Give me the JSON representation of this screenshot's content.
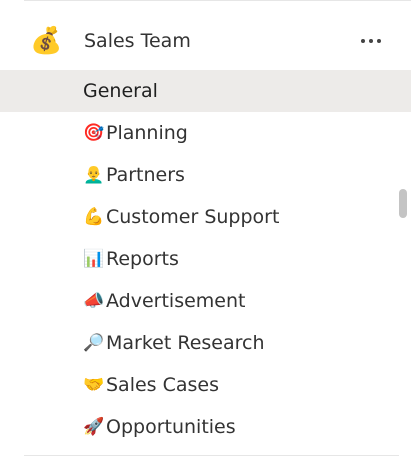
{
  "team": {
    "name": "Sales Team",
    "avatar_icon": "money-bag-icon",
    "avatar_glyph": "💰",
    "more_icon": "more-options-icon"
  },
  "channels": [
    {
      "label": "General",
      "icon": "",
      "glyph": "",
      "selected": true
    },
    {
      "label": "Planning",
      "icon": "target-icon",
      "glyph": "🎯",
      "selected": false
    },
    {
      "label": "Partners",
      "icon": "person-icon",
      "glyph": "👨‍🦲",
      "selected": false
    },
    {
      "label": "Customer Support",
      "icon": "flexed-biceps-icon",
      "glyph": "💪",
      "selected": false
    },
    {
      "label": "Reports",
      "icon": "bar-chart-icon",
      "glyph": "📊",
      "selected": false
    },
    {
      "label": "Advertisement",
      "icon": "megaphone-icon",
      "glyph": "📣",
      "selected": false
    },
    {
      "label": "Market Research",
      "icon": "magnifying-glass-icon",
      "glyph": "🔎",
      "selected": false
    },
    {
      "label": "Sales Cases",
      "icon": "handshake-icon",
      "glyph": "🤝",
      "selected": false
    },
    {
      "label": "Opportunities",
      "icon": "rocket-icon",
      "glyph": "🚀",
      "selected": false
    }
  ],
  "colors": {
    "selected_background": "#edebe9",
    "text": "#333333",
    "scrollbar": "#c4c4c4"
  }
}
